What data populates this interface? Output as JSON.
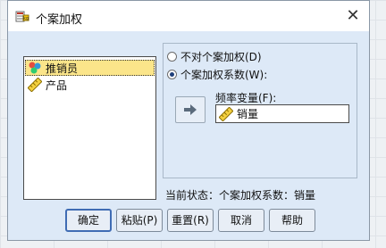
{
  "window": {
    "title": "个案加权",
    "icon": "weight-scale-icon",
    "close_label": "✕"
  },
  "variables": [
    {
      "label": "推销员",
      "icon": "nominal-variable-icon",
      "selected": true
    },
    {
      "label": "产品",
      "icon": "scale-variable-icon",
      "selected": false
    }
  ],
  "weighting": {
    "options": [
      {
        "label": "不对个案加权(D)",
        "checked": false
      },
      {
        "label": "个案加权系数(W):",
        "checked": true
      }
    ],
    "freq_label": "频率变量(F):",
    "freq_value": "销量",
    "move_icon": "arrow-right-icon"
  },
  "status": "当前状态：个案加权系数：销量",
  "buttons": {
    "ok": "确定",
    "paste": "粘贴(P)",
    "reset": "重置(R)",
    "cancel": "取消",
    "help": "帮助"
  },
  "colors": {
    "selection": "#fbe58a",
    "client_bg": "#dde9f7",
    "default_button_border": "#3f6cb4"
  }
}
